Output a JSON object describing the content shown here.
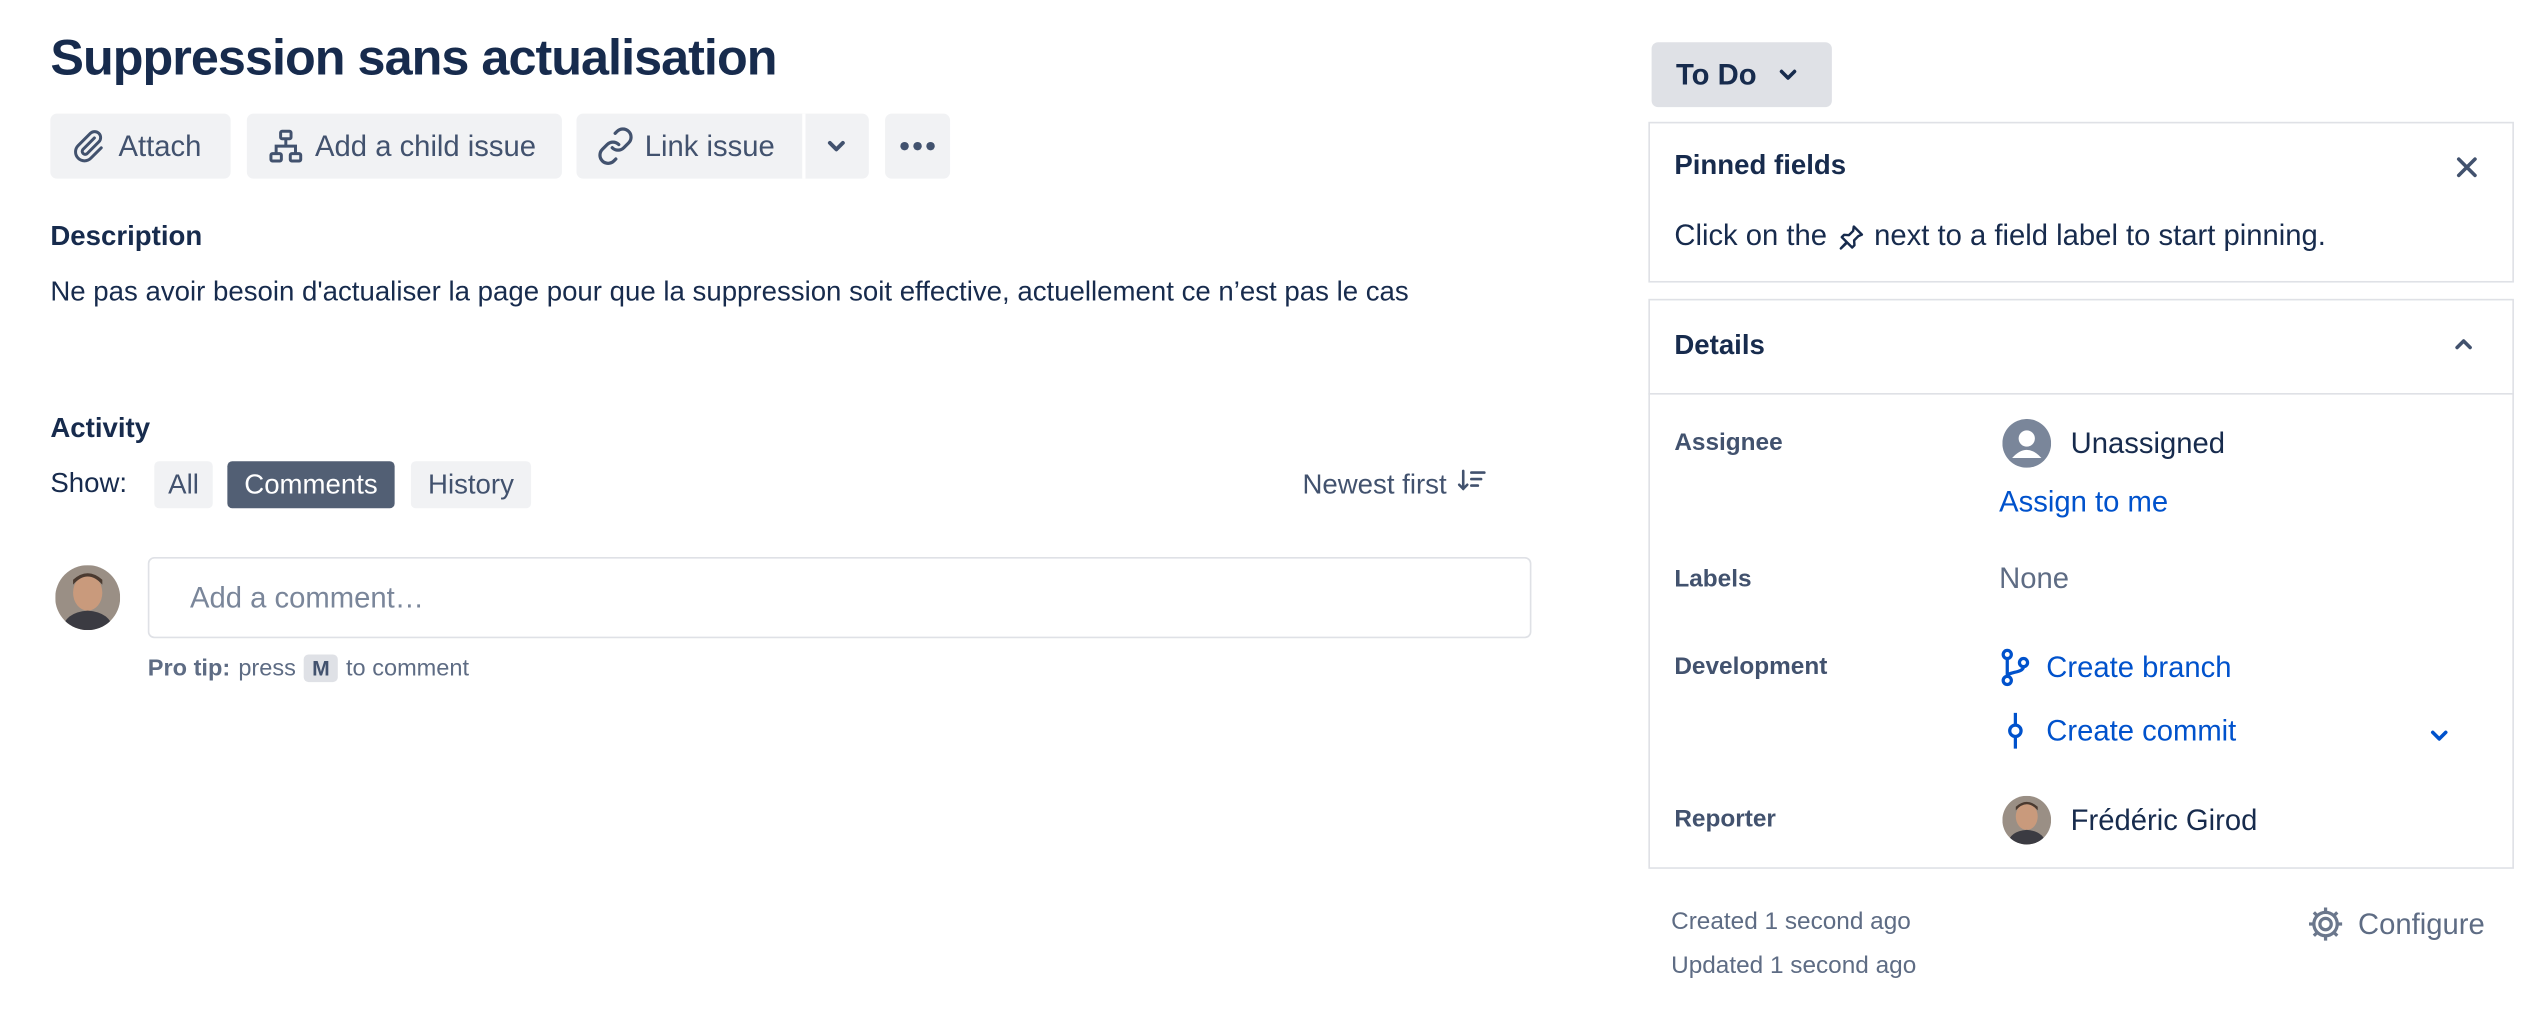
{
  "issue": {
    "title": "Suppression sans actualisation",
    "description": "Ne pas avoir besoin d'actualiser la page pour que la suppression soit effective, actuellement ce n’est pas le cas"
  },
  "toolbar": {
    "attach_label": "Attach",
    "child_issue_label": "Add a child issue",
    "link_issue_label": "Link issue"
  },
  "description": {
    "heading": "Description"
  },
  "activity": {
    "heading": "Activity",
    "show_label": "Show:",
    "filters": [
      "All",
      "Comments",
      "History"
    ],
    "selected_filter": "Comments",
    "sort_label": "Newest first",
    "comment_placeholder": "Add a comment…",
    "protip_label": "Pro tip:",
    "protip_press": "press",
    "protip_key": "M",
    "protip_suffix": "to comment"
  },
  "status": {
    "label": "To Do"
  },
  "pinned": {
    "heading": "Pinned fields",
    "hint_before": "Click on the",
    "hint_after": "next to a field label to start pinning."
  },
  "details": {
    "heading": "Details",
    "assignee_label": "Assignee",
    "assignee_value": "Unassigned",
    "assign_to_me": "Assign to me",
    "labels_label": "Labels",
    "labels_value": "None",
    "development_label": "Development",
    "create_branch": "Create branch",
    "create_commit": "Create commit",
    "reporter_label": "Reporter",
    "reporter_value": "Frédéric Girod"
  },
  "meta": {
    "created": "Created 1 second ago",
    "updated": "Updated 1 second ago",
    "configure": "Configure"
  },
  "colors": {
    "text": "#172b4d",
    "link": "#0052cc",
    "button_bg": "#f1f2f4",
    "selected_chip": "#525f74",
    "border": "#dfe1e6"
  }
}
